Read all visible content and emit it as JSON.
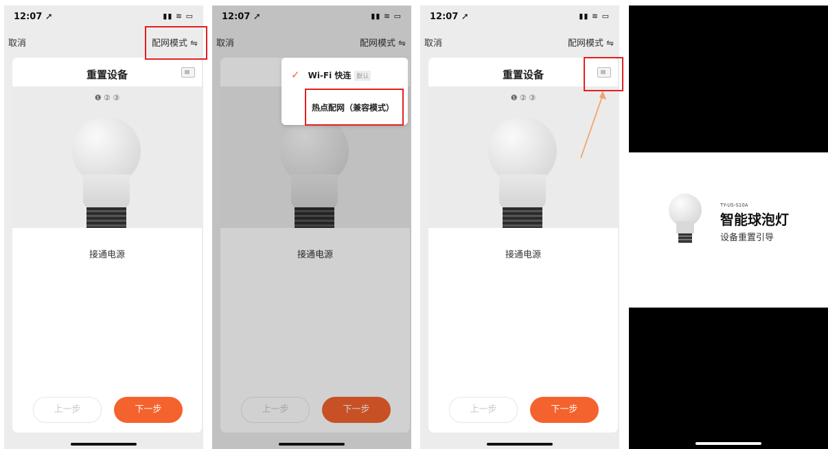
{
  "status": {
    "time": "12:07",
    "location_arrow": "➚",
    "icons": "▮▮ ≋ ▭"
  },
  "nav": {
    "cancel": "取消",
    "mode": "配网模式 ⇋"
  },
  "card": {
    "title": "重置设备",
    "steps": "❶ ② ③",
    "caption": "接通电源",
    "prev": "上一步",
    "next": "下一步"
  },
  "menu": {
    "check": "✓",
    "item1": "Wi-Fi 快连",
    "item1_badge": "默认",
    "item2": "热点配网（兼容模式）"
  },
  "video": {
    "model": "TY-US-S10A",
    "title": "智能球泡灯",
    "subtitle": "设备重置引导"
  },
  "colors": {
    "accent": "#f4622e",
    "highlight": "#e21d1d",
    "arrow": "#f2a36b"
  }
}
